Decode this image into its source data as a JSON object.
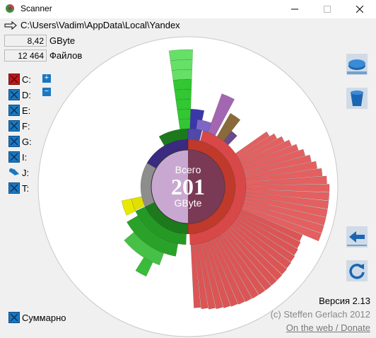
{
  "window": {
    "title": "Scanner"
  },
  "path": "C:\\Users\\Vadim\\AppData\\Local\\Yandex",
  "stats": {
    "size_value": "8,42",
    "size_unit": "GByte",
    "files_value": "12 464",
    "files_unit": "Файлов"
  },
  "drives": [
    {
      "label": "C:",
      "icon": "drive-c-icon-selected"
    },
    {
      "label": "D:",
      "icon": "drive-icon"
    },
    {
      "label": "E:",
      "icon": "drive-icon"
    },
    {
      "label": "F:",
      "icon": "drive-icon"
    },
    {
      "label": "G:",
      "icon": "drive-icon"
    },
    {
      "label": "I:",
      "icon": "drive-icon"
    },
    {
      "label": "J:",
      "icon": "network-drive-icon"
    },
    {
      "label": "T:",
      "icon": "drive-icon"
    }
  ],
  "zoom": {
    "in": "+",
    "out": "−"
  },
  "center": {
    "top": "Всего",
    "value": "201",
    "unit": "GByte"
  },
  "summary": {
    "label": "Суммарно"
  },
  "footer": {
    "version": "Версия 2.13",
    "copyright": "(c) Steffen Gerlach 2012",
    "link": "On the web / Donate"
  },
  "colors": {
    "green": "#2e9d2e",
    "red": "#d24a4a",
    "purple": "#7a5fb0",
    "yellow": "#f2f200",
    "blue_button": "#1a66b3"
  }
}
